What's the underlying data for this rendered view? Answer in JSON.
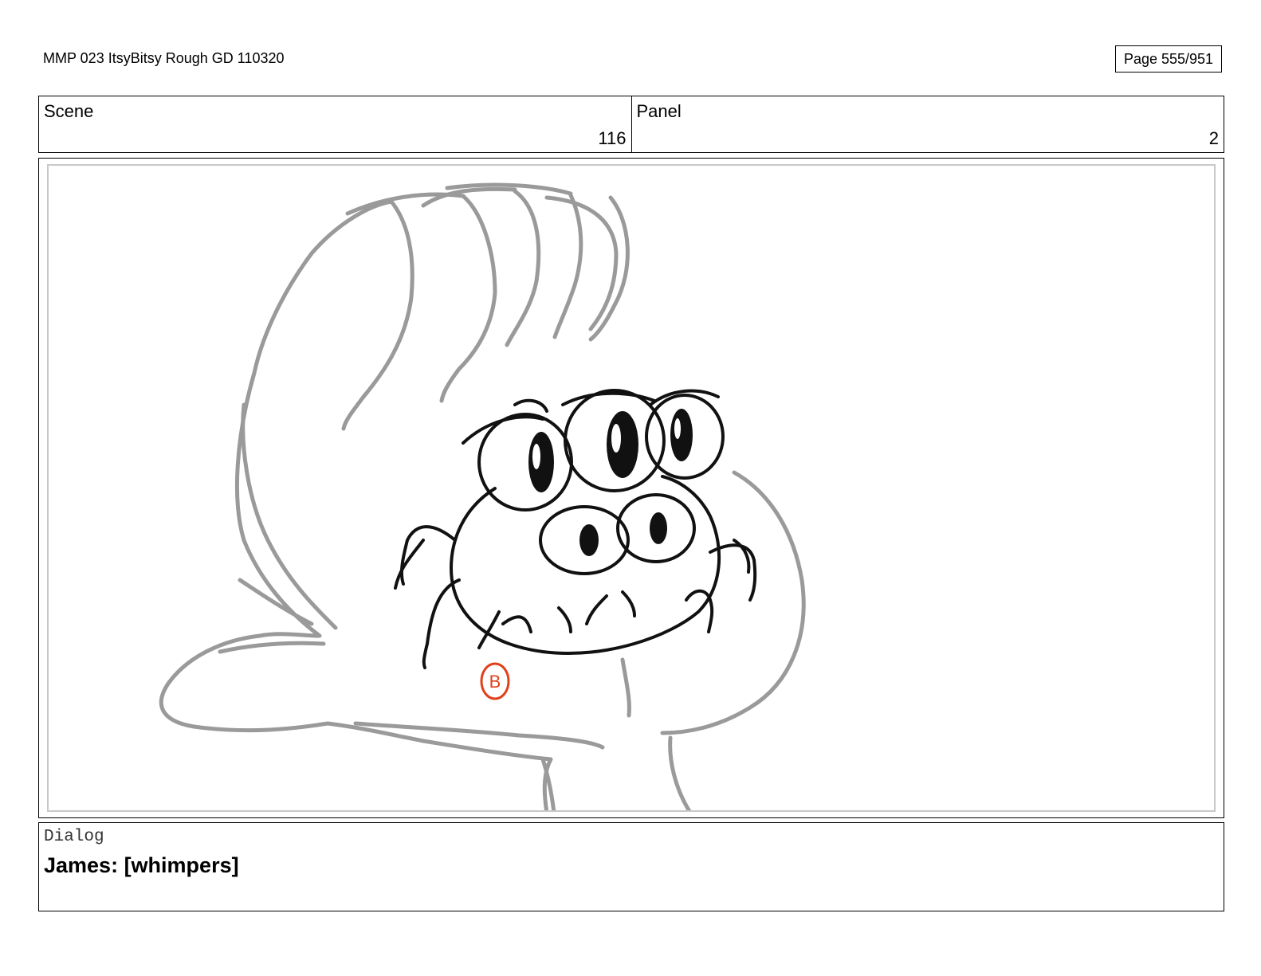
{
  "header": {
    "doc_title": "MMP 023 ItsyBitsy Rough GD 110320",
    "page_label": "Page 555/951"
  },
  "info": {
    "scene_label": "Scene",
    "scene_value": "116",
    "panel_label": "Panel",
    "panel_value": "2"
  },
  "sketch": {
    "stamp_letter": "B",
    "colors": {
      "hand": "#9a9a9a",
      "spider": "#111111",
      "stamp": "#e0401a"
    }
  },
  "dialog": {
    "label": "Dialog",
    "text": "James: [whimpers]"
  }
}
